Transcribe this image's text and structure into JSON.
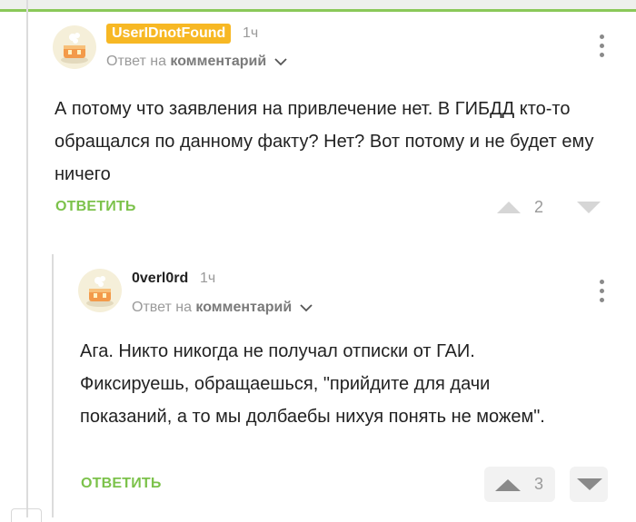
{
  "comments": [
    {
      "username": "UserIDnotFound",
      "time": "1ч",
      "reply_prefix": "Ответ на",
      "reply_target": "комментарий",
      "text": "А потому что заявления на привлечение нет. В ГИБДД кто-то обращался по данному факту? Нет? Вот потому и не будет ему ничего",
      "reply_label": "ОТВЕТИТЬ",
      "score": "2"
    },
    {
      "username": "0verl0rd",
      "time": "1ч",
      "reply_prefix": "Ответ на",
      "reply_target": "комментарий",
      "text": "Ага. Никто никогда не получал отписки от ГАИ. Фиксируешь, обращаешься, \"прийдите для дачи показаний, а то мы долбаебы нихуя понять не можем\".",
      "reply_label": "ОТВЕТИТЬ",
      "score": "3"
    }
  ],
  "colors": {
    "accent_green": "#7cc24b",
    "badge_orange": "#f7b824",
    "muted_gray": "#9a9a9a"
  },
  "icons": [
    "avatar-cake-icon",
    "chevron-down-icon",
    "kebab-menu-icon",
    "vote-up-icon",
    "vote-down-icon"
  ]
}
